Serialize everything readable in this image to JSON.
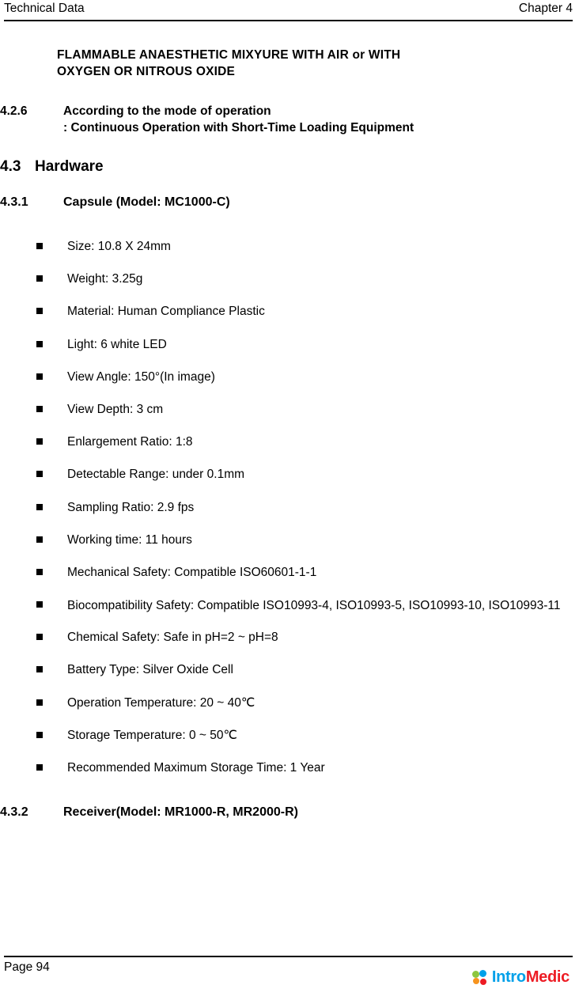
{
  "header": {
    "left": "Technical Data",
    "right": "Chapter 4"
  },
  "intro": {
    "line1": "FLAMMABLE ANAESTHETIC MIXYURE WITH AIR or WITH",
    "line2": "OXYGEN OR NITROUS OXIDE"
  },
  "section_426": {
    "number": "4.2.6",
    "title": "According to the mode of operation",
    "subtitle": ": Continuous Operation with Short-Time Loading Equipment"
  },
  "section_43": {
    "number": "4.3",
    "title": "Hardware"
  },
  "section_431": {
    "number": "4.3.1",
    "title": "Capsule (Model: MC1000-C)"
  },
  "specs": [
    {
      "text": "Size: 10.8 X 24mm"
    },
    {
      "text": "Weight: 3.25g"
    },
    {
      "text": "Material: Human Compliance Plastic"
    },
    {
      "text": "Light: 6 white LED"
    },
    {
      "text": "View Angle: 150°(In image)"
    },
    {
      "text": "View Depth: 3 cm"
    },
    {
      "text": "Enlargement Ratio: 1:8"
    },
    {
      "text": "Detectable Range: under 0.1mm"
    },
    {
      "text": "Sampling Ratio: 2.9 fps"
    },
    {
      "text": "Working time: 11 hours"
    },
    {
      "text": "Mechanical Safety: Compatible ISO60601-1-1"
    },
    {
      "text": "Biocompatibility Safety: Compatible ISO10993-4, ISO10993-5, ISO10993-10, ISO10993-11"
    },
    {
      "text": "Chemical Safety: Safe in pH=2 ~ pH=8"
    },
    {
      "text": "Battery Type: Silver Oxide Cell"
    },
    {
      "text": "Operation Temperature: 20 ~ 40℃"
    },
    {
      "text": "Storage Temperature: 0 ~ 50℃"
    },
    {
      "text": "Recommended Maximum Storage Time: 1 Year"
    }
  ],
  "section_432": {
    "number": "4.3.2",
    "title": "Receiver(Model: MR1000-R, MR2000-R)"
  },
  "footer": {
    "page": "Page 94",
    "logo_part1": "Intro",
    "logo_part2": "Medic"
  }
}
